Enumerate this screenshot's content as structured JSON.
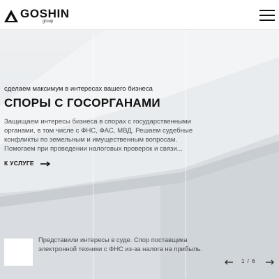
{
  "brand": {
    "name": "GOSHIN",
    "sub": "group"
  },
  "hero": {
    "tagline": "сделаем максимум в интересах вашего бизнеса",
    "title": "СПОРЫ С ГОСОРГАНАМИ",
    "description": "Защищаем интересы бизнеса в спорах с государственными органами, в том числе с ФНС, ФАС, МВД. Решаем судебные конфликты по земельным и имущественным вопросам. Помогаем при проведении налоговых проверок и связи...",
    "cta_label": "К УСЛУГЕ"
  },
  "case_card": {
    "text": "Представили интересы в суде. Спор поставщика электронной техники с ФНС из-за налога на прибыль."
  },
  "pager": {
    "label": "1  /  6",
    "current": 1,
    "total": 6
  },
  "icons": {
    "logo": "triangle-logo-icon",
    "menu": "hamburger-menu-icon",
    "cta": "arrow-right-icon",
    "prev": "arrow-left-icon",
    "next": "arrow-right-icon"
  }
}
